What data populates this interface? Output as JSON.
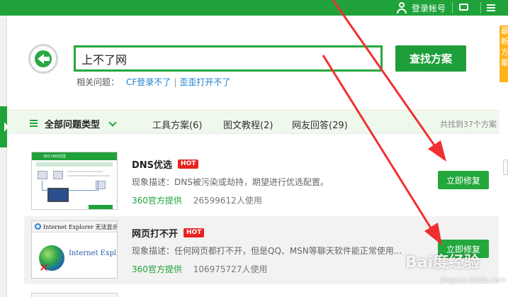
{
  "topbar": {
    "login_label": "登录帐号"
  },
  "right_widget_text": "最新方案",
  "search": {
    "value": "上不了网",
    "button_label": "查找方案"
  },
  "related": {
    "label": "相关问题：",
    "links": [
      "CF登录不了",
      "歪歪打开不了"
    ]
  },
  "filter": {
    "all_label": "全部问题类型",
    "tabs": [
      "工具方案(6)",
      "图文教程(2)",
      "网友回答(29)"
    ],
    "result_count": "共找到37个方案"
  },
  "items": [
    {
      "title": "DNS优选",
      "badge": "HOT",
      "description": "现象描述：DNS被污染或劫持，期望进行优选配置。",
      "provider": "360官方提供",
      "users": "26599612人使用",
      "button_label": "立即修复",
      "thumb_title": "360 DNS优选"
    },
    {
      "title": "网页打不开",
      "badge": "HOT",
      "description": "现象描述：任何网页都打不开，但是QQ、MSN等聊天软件能正常使用...",
      "provider": "360官方提供",
      "users": "106975727人使用",
      "button_label": "立即修复",
      "thumb_title": "Internet Explorer 无法显示",
      "thumb_body": "Internet Expl"
    }
  ],
  "watermark": {
    "main": "Bai度经验",
    "sub": "jingyan.baidu.com"
  },
  "colors": {
    "brand_green": "#1fa23a",
    "hot_red": "#e8231f",
    "link_blue": "#1a7fd1",
    "arrow_red": "#f03030"
  }
}
